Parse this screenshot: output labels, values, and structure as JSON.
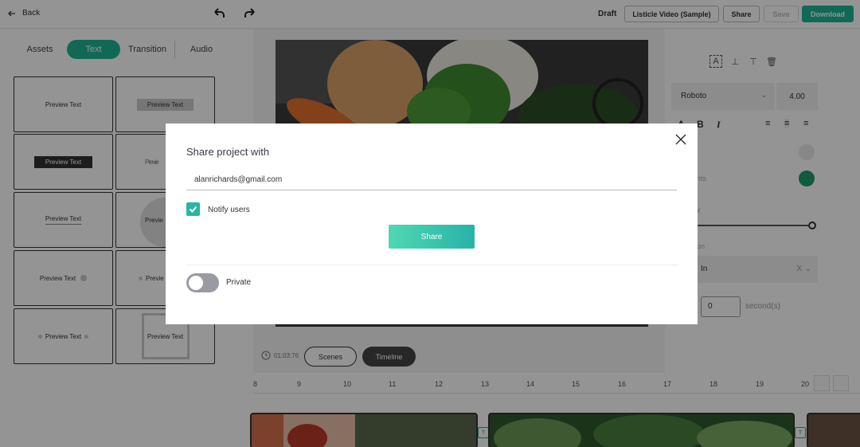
{
  "topbar": {
    "back_label": "Back",
    "status": "Draft",
    "project_title": "Listicle Video (Sample)",
    "share_label": "Share",
    "save_label": "Save",
    "download_label": "Download",
    "accent_color": "#1cb694"
  },
  "left_panel": {
    "tabs": [
      "Assets",
      "Text",
      "Transition",
      "Audio"
    ],
    "active_tab": "Text",
    "preview_text": "Preview Text",
    "preview_text_partial": "Previe"
  },
  "canvas": {
    "duration": "01:03:76",
    "scenes_label": "Scenes",
    "timeline_label": "Timeline"
  },
  "right_panel": {
    "font_family": "Roboto",
    "font_size": "4.00",
    "label_nts": "nts",
    "label_y": "y",
    "label_on": "on",
    "animation_value": "In",
    "clear_mark": "X",
    "delay_value": "0",
    "delay_unit": "second(s)"
  },
  "timeline": {
    "ticks": [
      "8",
      "9",
      "10",
      "11",
      "12",
      "13",
      "14",
      "15",
      "16",
      "17",
      "18",
      "19",
      "20"
    ]
  },
  "modal": {
    "title": "Share project with",
    "email_value": "alanrichards@gmail.com",
    "notify_label": "Notify users",
    "notify_checked": true,
    "share_button": "Share",
    "private_label": "Private",
    "private_on": false
  }
}
